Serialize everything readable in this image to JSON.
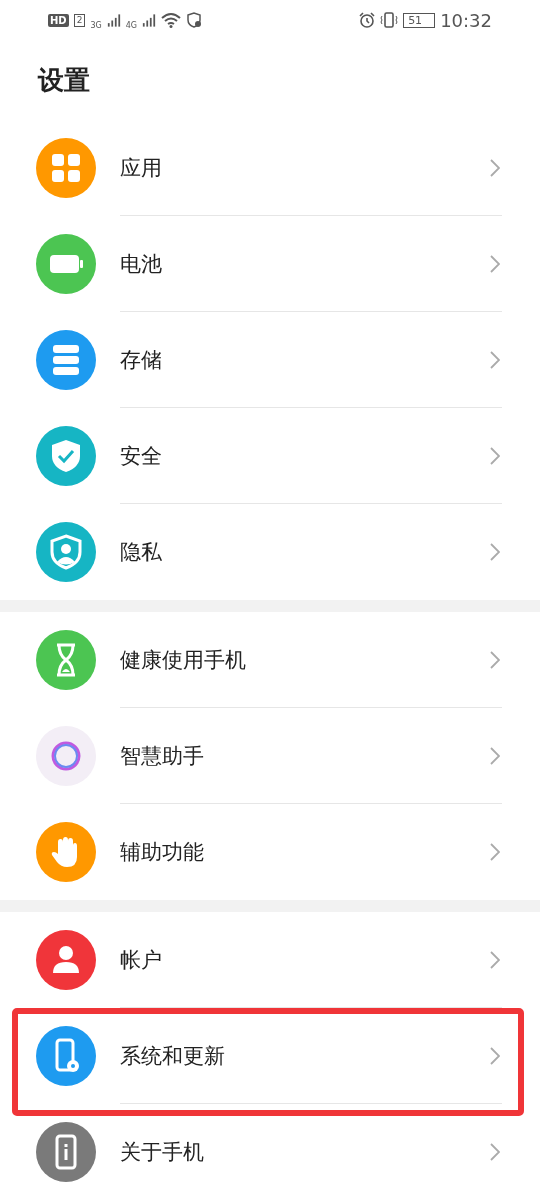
{
  "status_bar": {
    "hd": "HD",
    "sim": "2",
    "net1": "3G",
    "net2": "4G",
    "battery": "51",
    "time": "10:32"
  },
  "title": "设置",
  "groups": [
    {
      "items": [
        {
          "label": "应用",
          "kind": "apps",
          "color": "#ff9800",
          "highlighted": false
        },
        {
          "label": "电池",
          "kind": "battery",
          "color": "#4cc552",
          "highlighted": false
        },
        {
          "label": "存储",
          "kind": "storage",
          "color": "#1e9bf0",
          "highlighted": false
        },
        {
          "label": "安全",
          "kind": "shield",
          "color": "#16b5c4",
          "highlighted": false
        },
        {
          "label": "隐私",
          "kind": "privacy",
          "color": "#16b5c4",
          "highlighted": false
        }
      ]
    },
    {
      "items": [
        {
          "label": "健康使用手机",
          "kind": "hourglass",
          "color": "#4cc552",
          "highlighted": false
        },
        {
          "label": "智慧助手",
          "kind": "ring",
          "color": "#f3eef6",
          "highlighted": false
        },
        {
          "label": "辅助功能",
          "kind": "hand",
          "color": "#ff9800",
          "highlighted": false
        }
      ]
    },
    {
      "items": [
        {
          "label": "帐户",
          "kind": "person",
          "color": "#f0353a",
          "highlighted": false
        },
        {
          "label": "系统和更新",
          "kind": "phonegear",
          "color": "#1e9bf0",
          "highlighted": true
        },
        {
          "label": "关于手机",
          "kind": "phoneinfo",
          "color": "#7a7a7a",
          "highlighted": false
        }
      ]
    }
  ]
}
